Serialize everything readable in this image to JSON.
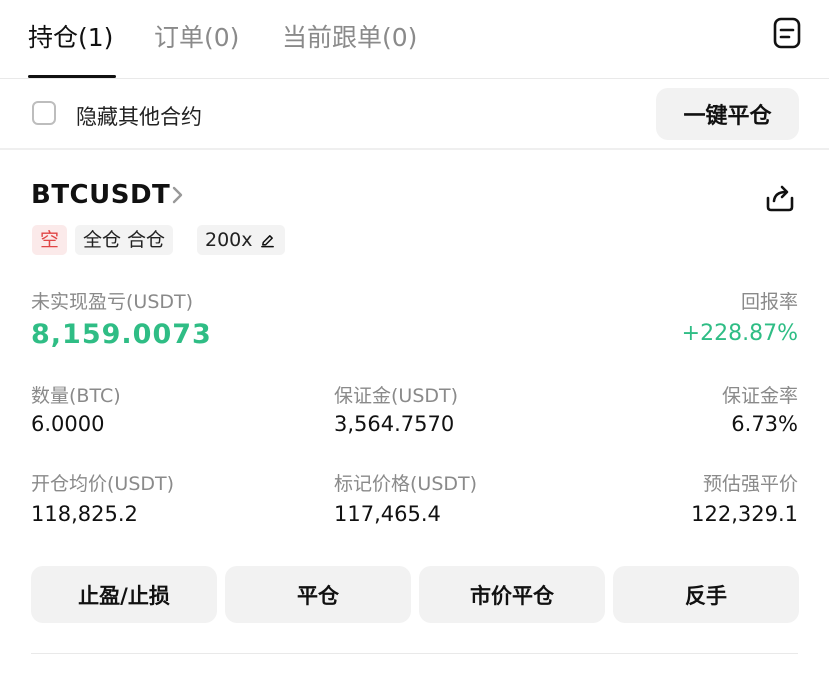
{
  "tabs": [
    {
      "label": "持仓(1)"
    },
    {
      "label": "订单(0)"
    },
    {
      "label": "当前跟单(0)"
    }
  ],
  "filter": {
    "hide_others_label": "隐藏其他合约",
    "hide_others_checked": false,
    "close_all_label": "一键平仓"
  },
  "position": {
    "symbol": "BTCUSDT",
    "side_tag": "空",
    "margin_mode_tag": "全仓 合仓",
    "leverage_tag": "200x",
    "pnl_label": "未实现盈亏(USDT)",
    "pnl_value": "8,159.0073",
    "roe_label": "回报率",
    "roe_value": "+228.87%",
    "qty_label": "数量(BTC)",
    "qty_value": "6.0000",
    "margin_label": "保证金(USDT)",
    "margin_value": "3,564.7570",
    "margin_ratio_label": "保证金率",
    "margin_ratio_value": "6.73%",
    "entry_label": "开仓均价(USDT)",
    "entry_value": "118,825.2",
    "mark_label": "标记价格(USDT)",
    "mark_value": "117,465.4",
    "liq_label": "预估强平价",
    "liq_value": "122,329.1"
  },
  "actions": [
    {
      "label": "止盈/止损"
    },
    {
      "label": "平仓"
    },
    {
      "label": "市价平仓"
    },
    {
      "label": "反手"
    }
  ],
  "colors": {
    "profit": "#2fbd85",
    "short": "#e04646"
  },
  "icons": {
    "notes": "notes-icon",
    "chevron": "chevron-right-icon",
    "share": "share-icon",
    "edit": "pencil-icon"
  }
}
